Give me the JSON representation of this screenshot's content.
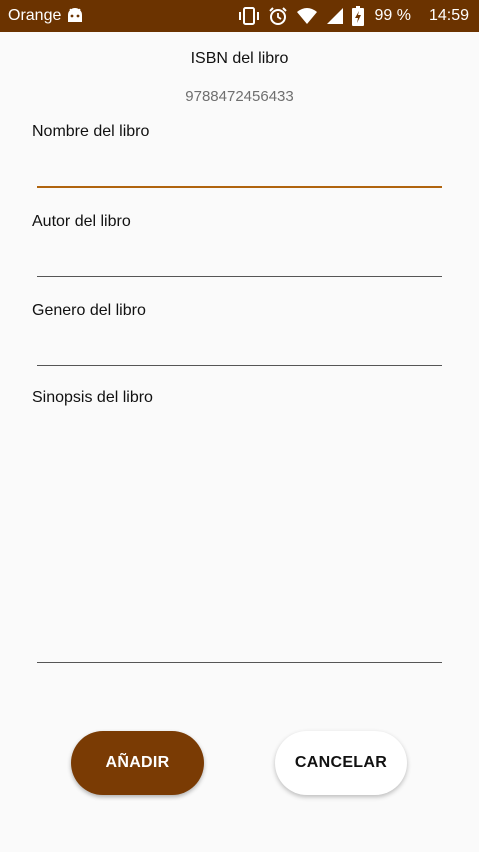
{
  "status_bar": {
    "carrier": "Orange",
    "battery_text": "99 %",
    "time": "14:59",
    "icons": [
      "android-icon",
      "vibrate-icon",
      "alarm-icon",
      "wifi-icon",
      "signal-icon",
      "battery-charging-icon"
    ]
  },
  "form": {
    "isbn_label": "ISBN del libro",
    "isbn_value": "9788472456433",
    "fields": [
      {
        "label": "Nombre del libro",
        "value": ""
      },
      {
        "label": "Autor del libro",
        "value": ""
      },
      {
        "label": "Genero del libro",
        "value": ""
      },
      {
        "label": "Sinopsis del libro",
        "value": ""
      }
    ]
  },
  "buttons": {
    "add_label": "AÑADIR",
    "cancel_label": "CANCELAR"
  },
  "colors": {
    "status_bar": "#6b3300",
    "accent": "#b0640e",
    "primary_button": "#7a3b04"
  }
}
